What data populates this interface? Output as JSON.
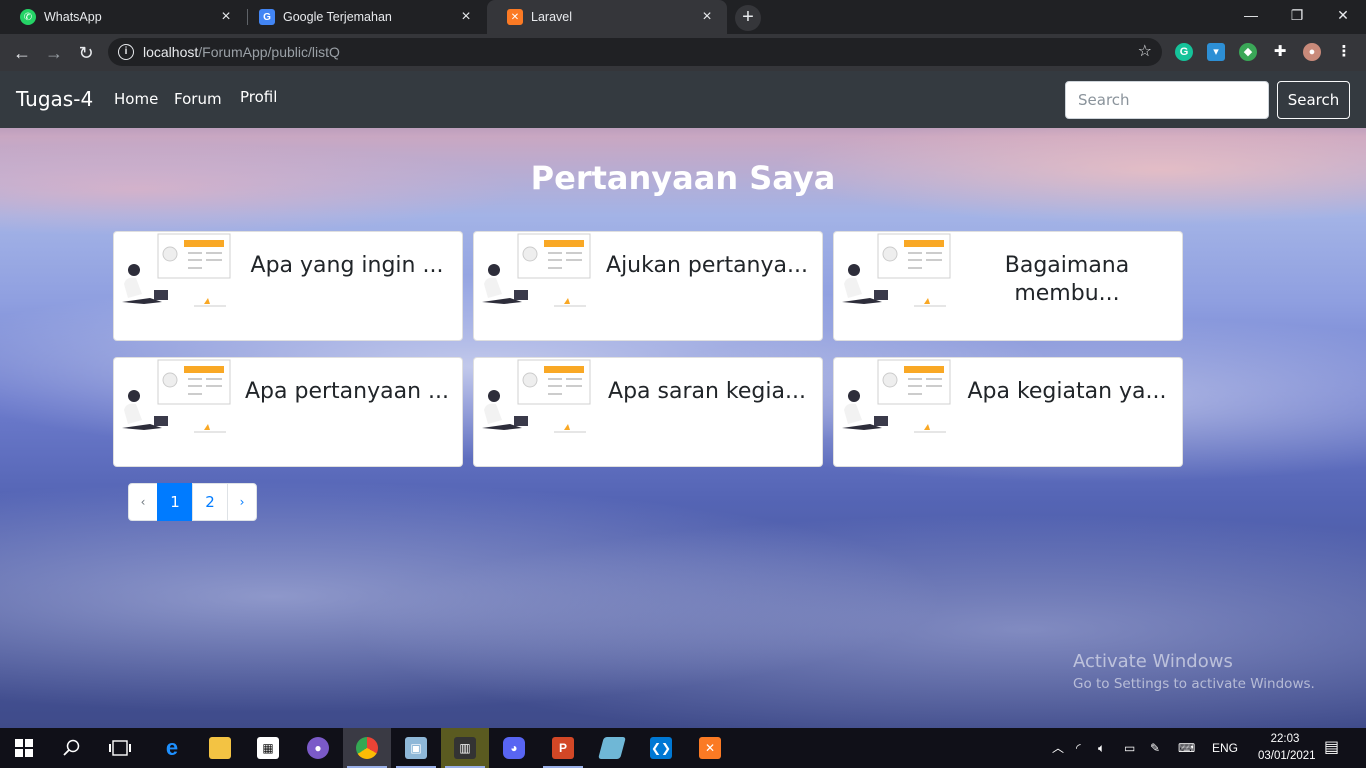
{
  "browser": {
    "tabs": [
      {
        "title": "WhatsApp",
        "icon": "whatsapp-icon",
        "color": "#25d366"
      },
      {
        "title": "Google Terjemahan",
        "icon": "google-translate-icon",
        "color": "#4285f4"
      },
      {
        "title": "Laravel",
        "icon": "xampp-icon",
        "color": "#fb7a24"
      }
    ],
    "url_host": "localhost",
    "url_path": "/ForumApp/public/listQ"
  },
  "navbar": {
    "brand": "Tugas-4",
    "links": [
      "Home",
      "Forum",
      "Profil"
    ],
    "search_placeholder": "Search",
    "search_button": "Search"
  },
  "main": {
    "title": "Pertanyaan Saya",
    "cards": [
      {
        "text": "Apa yang ingin ..."
      },
      {
        "text": "Ajukan pertanya..."
      },
      {
        "text": "Bagaimana membu..."
      },
      {
        "text": "Apa pertanyaan ..."
      },
      {
        "text": "Apa saran kegia..."
      },
      {
        "text": "Apa kegiatan ya..."
      }
    ],
    "pagination": {
      "prev": "‹",
      "pages": [
        "1",
        "2"
      ],
      "next": "›",
      "current": "1"
    }
  },
  "watermark": {
    "line1": "Activate Windows",
    "line2": "Go to Settings to activate Windows."
  },
  "taskbar": {
    "language": "ENG",
    "time": "22:03",
    "date": "03/01/2021"
  }
}
